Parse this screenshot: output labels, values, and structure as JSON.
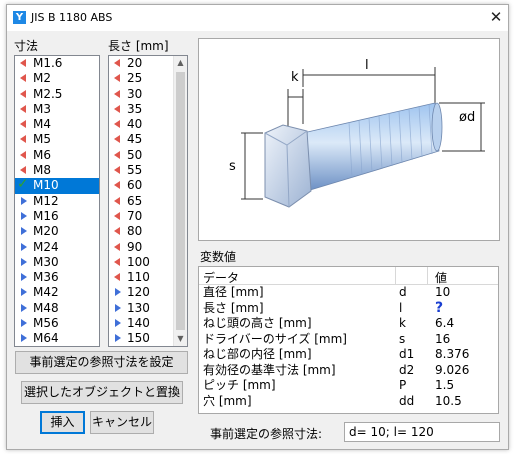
{
  "window": {
    "title": "JIS B 1180 ABS",
    "icon_letter": "Y"
  },
  "labels": {
    "size_header": "寸法",
    "length_header": "長さ [mm]",
    "variables_header": "変数値",
    "summary_label": "事前選定の参照寸法:"
  },
  "sizes": [
    {
      "label": "M1.6",
      "mark": "left"
    },
    {
      "label": "M2",
      "mark": "left"
    },
    {
      "label": "M2.5",
      "mark": "left"
    },
    {
      "label": "M3",
      "mark": "left"
    },
    {
      "label": "M4",
      "mark": "left"
    },
    {
      "label": "M5",
      "mark": "left"
    },
    {
      "label": "M6",
      "mark": "left"
    },
    {
      "label": "M8",
      "mark": "left"
    },
    {
      "label": "M10",
      "mark": "check",
      "selected": true
    },
    {
      "label": "M12",
      "mark": "right"
    },
    {
      "label": "M16",
      "mark": "right"
    },
    {
      "label": "M20",
      "mark": "right"
    },
    {
      "label": "M24",
      "mark": "right"
    },
    {
      "label": "M30",
      "mark": "right"
    },
    {
      "label": "M36",
      "mark": "right"
    },
    {
      "label": "M42",
      "mark": "right"
    },
    {
      "label": "M48",
      "mark": "right"
    },
    {
      "label": "M56",
      "mark": "right"
    },
    {
      "label": "M64",
      "mark": "right"
    }
  ],
  "lengths": [
    {
      "label": "20",
      "mark": "left"
    },
    {
      "label": "25",
      "mark": "left"
    },
    {
      "label": "30",
      "mark": "left"
    },
    {
      "label": "35",
      "mark": "left"
    },
    {
      "label": "40",
      "mark": "left"
    },
    {
      "label": "45",
      "mark": "left"
    },
    {
      "label": "50",
      "mark": "left"
    },
    {
      "label": "55",
      "mark": "left"
    },
    {
      "label": "60",
      "mark": "left"
    },
    {
      "label": "65",
      "mark": "left"
    },
    {
      "label": "70",
      "mark": "left"
    },
    {
      "label": "80",
      "mark": "left"
    },
    {
      "label": "90",
      "mark": "left"
    },
    {
      "label": "100",
      "mark": "left"
    },
    {
      "label": "110",
      "mark": "left"
    },
    {
      "label": "120",
      "mark": "right"
    },
    {
      "label": "130",
      "mark": "right"
    },
    {
      "label": "140",
      "mark": "right"
    },
    {
      "label": "150",
      "mark": "right"
    }
  ],
  "scroll_arrows": {
    "up": "▲",
    "down": "▼"
  },
  "buttons": {
    "set_ref": "事前選定の参照寸法を設定",
    "replace": "選択したオブジェクトと置換",
    "insert": "挿入",
    "cancel": "キャンセル"
  },
  "table": {
    "headers": [
      "データ",
      "",
      "値"
    ],
    "rows": [
      {
        "name": "直径 [mm]",
        "sym": "d",
        "val": "10"
      },
      {
        "name": "長さ [mm]",
        "sym": "l",
        "val": "?"
      },
      {
        "name": "ねじ頭の高さ [mm]",
        "sym": "k",
        "val": "6.4"
      },
      {
        "name": "ドライバーのサイズ [mm]",
        "sym": "s",
        "val": "16"
      },
      {
        "name": "ねじ部の内径 [mm]",
        "sym": "d1",
        "val": "8.376"
      },
      {
        "name": "有効径の基準寸法 [mm]",
        "sym": "d2",
        "val": "9.026"
      },
      {
        "name": "ピッチ [mm]",
        "sym": "P",
        "val": "1.5"
      },
      {
        "name": "穴 [mm]",
        "sym": "dd",
        "val": "10.5"
      }
    ]
  },
  "diagram_labels": {
    "k": "k",
    "l": "l",
    "d": "ød",
    "s": "s"
  },
  "summary_value": "d= 10; l= 120",
  "close_glyph": "✕",
  "colors": {
    "selection": "#0078d7",
    "mark_left": "#e0564c",
    "mark_right": "#3f6fd8",
    "check": "#2fa12f",
    "question": "#1a3fd1"
  }
}
